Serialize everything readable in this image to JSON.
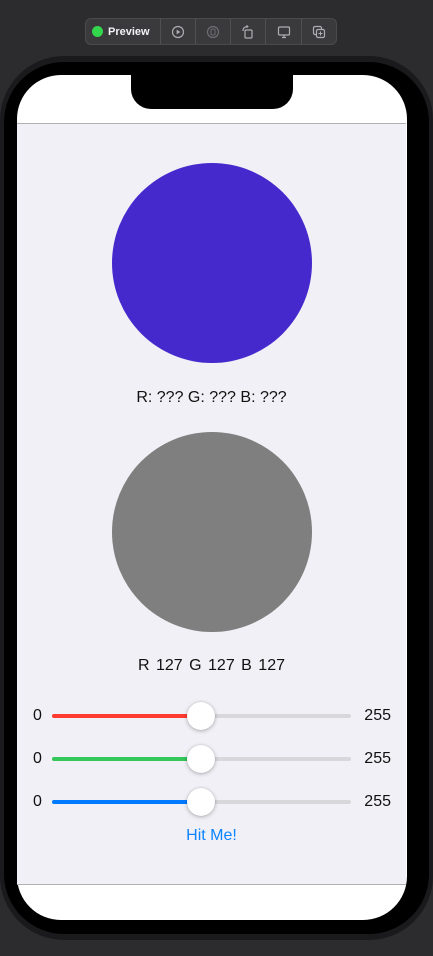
{
  "toolbar": {
    "preview_label": "Preview",
    "status_color": "#32d74b",
    "icons": [
      "live-preview-icon",
      "selectable-icon",
      "rotate-device-icon",
      "device-settings-icon",
      "duplicate-icon"
    ]
  },
  "target": {
    "color": "#4529cc",
    "caption": "R: ??? G: ??? B: ???"
  },
  "current": {
    "color": "#7f7f7f",
    "caption": "R 127  G 127  B 127"
  },
  "sliders": [
    {
      "name": "red",
      "min_label": "0",
      "max_label": "255",
      "value": 127,
      "max": 255,
      "color": "#ff3b30"
    },
    {
      "name": "green",
      "min_label": "0",
      "max_label": "255",
      "value": 127,
      "max": 255,
      "color": "#34c759"
    },
    {
      "name": "blue",
      "min_label": "0",
      "max_label": "255",
      "value": 127,
      "max": 255,
      "color": "#007aff"
    }
  ],
  "button": {
    "label": "Hit Me!"
  }
}
